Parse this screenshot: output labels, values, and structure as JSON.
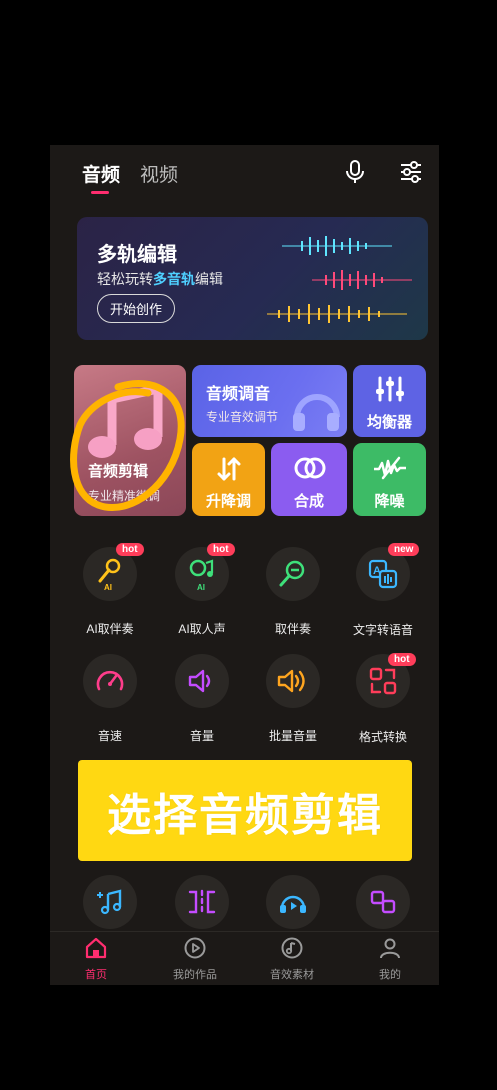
{
  "tabs": {
    "audio": "音频",
    "video": "视频"
  },
  "icons": {
    "mic": "microphone-icon",
    "settings": "sliders-icon"
  },
  "banner": {
    "title": "多轨编辑",
    "sub_prefix": "轻松玩转",
    "sub_highlight": "多音轨",
    "sub_suffix": "编辑",
    "button": "开始创作"
  },
  "tiles": {
    "audio_edit": {
      "label": "音频剪辑",
      "sub": "专业精准微调"
    },
    "audio_tune": {
      "label": "音频调音",
      "sub": "专业音效调节"
    },
    "equalizer": {
      "label": "均衡器"
    },
    "pitch": {
      "label": "升降调"
    },
    "merge": {
      "label": "合成"
    },
    "denoise": {
      "label": "降噪"
    }
  },
  "tools": [
    {
      "label": "AI取伴奏",
      "badge": "hot"
    },
    {
      "label": "AI取人声",
      "badge": "hot"
    },
    {
      "label": "取伴奏",
      "badge": ""
    },
    {
      "label": "文字转语音",
      "badge": "new"
    },
    {
      "label": "音速",
      "badge": ""
    },
    {
      "label": "音量",
      "badge": ""
    },
    {
      "label": "批量音量",
      "badge": ""
    },
    {
      "label": "格式转换",
      "badge": "hot"
    }
  ],
  "ai_mark": "AI",
  "cta": "选择音频剪辑",
  "bottom_nav": [
    {
      "label": "首页"
    },
    {
      "label": "我的作品"
    },
    {
      "label": "音效素材"
    },
    {
      "label": "我的"
    }
  ],
  "colors": {
    "accent": "#ff2d6f",
    "cta": "#ffd812",
    "highlight_ring": "#ffb400"
  }
}
